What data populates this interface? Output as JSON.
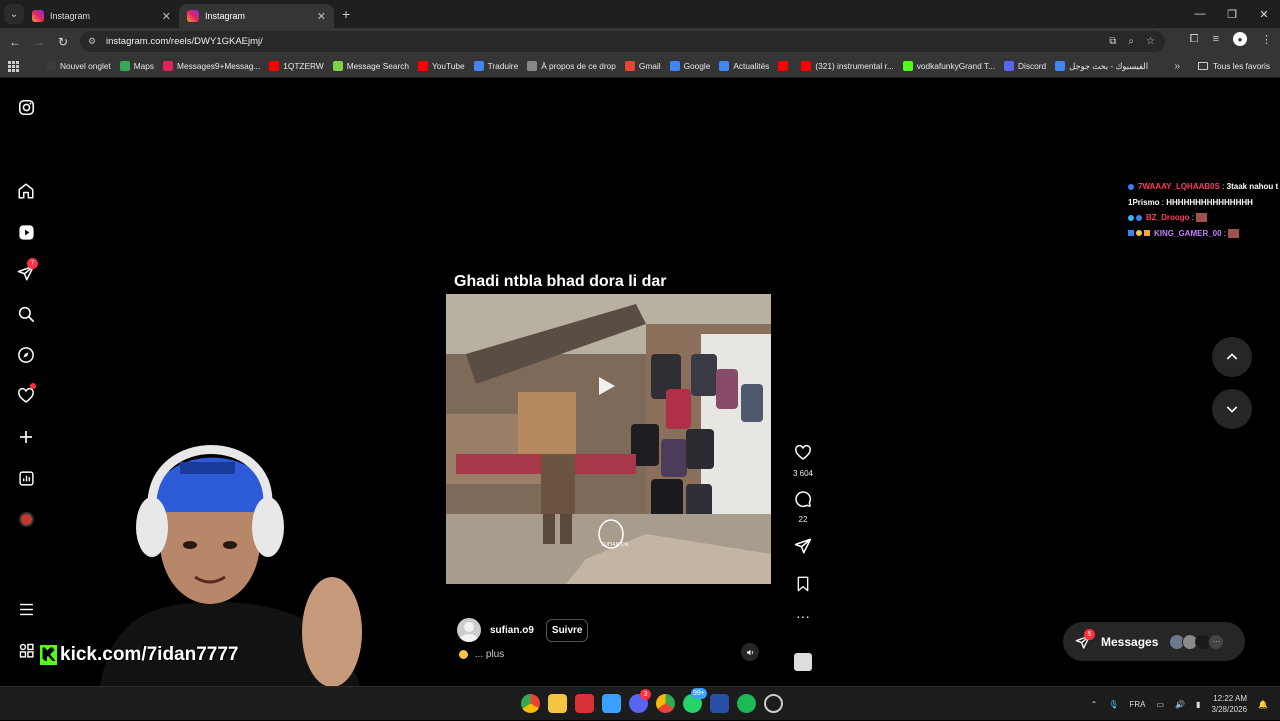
{
  "browser": {
    "tabs": [
      {
        "title": "Instagram",
        "active": false
      },
      {
        "title": "Instagram",
        "active": true
      }
    ],
    "url": "instagram.com/reels/DWY1GKAEjmj/",
    "bookmarks": [
      {
        "label": "Nouvel onglet",
        "color": "#3a3a3a"
      },
      {
        "label": "Maps",
        "color": "#34a853"
      },
      {
        "label": "Messages9+Messag...",
        "color": "#e3245b"
      },
      {
        "label": "1QTZERW",
        "color": "#ff0000"
      },
      {
        "label": "Message Search",
        "color": "#7bd148"
      },
      {
        "label": "YouTube",
        "color": "#ff0000"
      },
      {
        "label": "Traduire",
        "color": "#4285f4"
      },
      {
        "label": "À propos de ce drop",
        "color": "#888888"
      },
      {
        "label": "Gmail",
        "color": "#ea4335"
      },
      {
        "label": "Google",
        "color": "#4285f4"
      },
      {
        "label": "Actualités",
        "color": "#4285f4"
      },
      {
        "label": "",
        "color": "#ff0000"
      },
      {
        "label": "(321) instrumental r...",
        "color": "#ff0000"
      },
      {
        "label": "vodkafunkyGrand T...",
        "color": "#53fc18"
      },
      {
        "label": "Discord",
        "color": "#5865f2"
      },
      {
        "label": "الفيسبوك - بحث جوجل",
        "color": "#4285f4"
      }
    ],
    "bookmarks_all": "Tous les favoris"
  },
  "sidebar": {
    "notifications_badge": "7"
  },
  "reel": {
    "title": "Ghadi ntbla bhad dora li dar",
    "username": "sufian.o9",
    "follow_label": "Suivre",
    "caption": "... plus",
    "likes": "3 604",
    "comments": "22",
    "watermark": "SUFIAN.O9"
  },
  "chat": [
    {
      "user": "7WAAAY_LQHAAB0S",
      "color": "#ff3b5c",
      "text": "3taak nahou t"
    },
    {
      "user": "1Prismo",
      "color": "#ffffff",
      "text": "HHHHHHHHHHHHHHH"
    },
    {
      "user": "BZ_Droogo",
      "color": "#ff3b5c",
      "text": ""
    },
    {
      "user": "KING_GAMER_00",
      "color": "#c77dff",
      "text": ""
    }
  ],
  "messages": {
    "label": "Messages",
    "badge": "5"
  },
  "stream": {
    "kick_url": "kick.com/7idan7777"
  },
  "taskbar": {
    "language": "FRA",
    "time": "12:22 AM",
    "date": "3/28/2026",
    "discord_badge": "3",
    "whatsapp_badge": "99+"
  }
}
